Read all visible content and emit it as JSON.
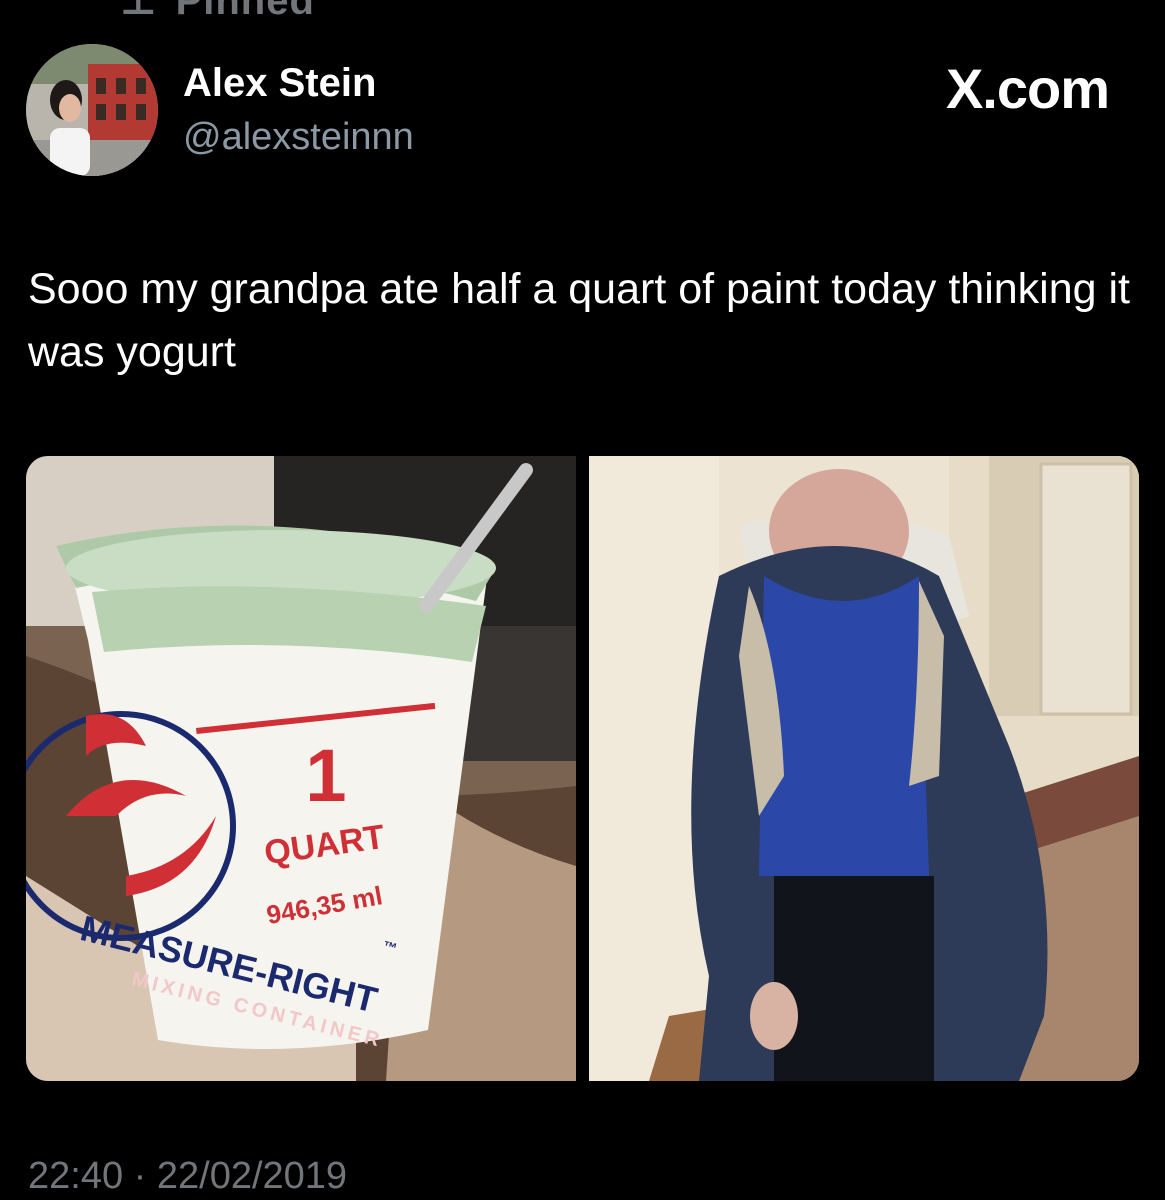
{
  "pinned": {
    "label": "Pinned"
  },
  "author": {
    "name": "Alex Stein",
    "handle": "@alexsteinnn"
  },
  "watermark": "X.com",
  "tweet": {
    "text": "Sooo my grandpa ate half a quart of paint today thinking it was yogurt",
    "timestamp": "22:40 · 22/02/2019"
  },
  "media": {
    "left_photo": {
      "container_number": "1",
      "container_unit": "QUART",
      "container_volume": "946,35 ml",
      "container_brand": "MEASURE-RIGHT",
      "container_tm": "™",
      "container_subtitle": "MIXING CONTAINER"
    },
    "right_photo": {}
  },
  "colors": {
    "background": "#000000",
    "text_primary": "#ffffff",
    "text_secondary": "#71767b",
    "paint_green": "#b8d4b4"
  }
}
